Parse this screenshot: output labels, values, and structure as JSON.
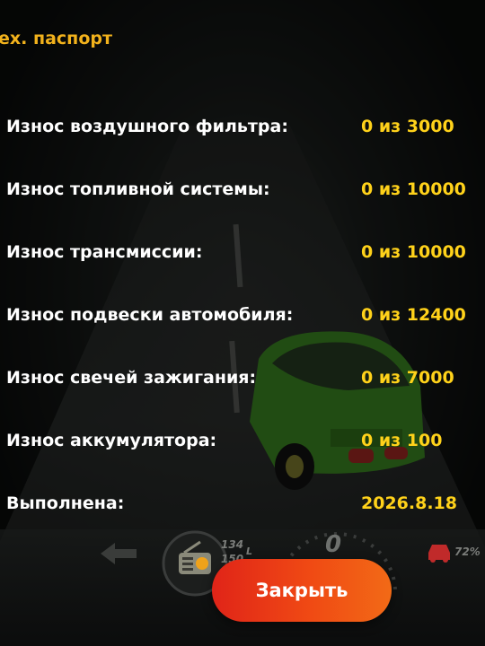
{
  "panel": {
    "title": "ex. паспорт",
    "rows": [
      {
        "label": "Износ воздушного фильтра:",
        "value": "0 из 3000"
      },
      {
        "label": "Износ топливной системы:",
        "value": "0 из 10000"
      },
      {
        "label": "Износ трансмиссии:",
        "value": "0 из 10000"
      },
      {
        "label": "Износ подвески автомобиля:",
        "value": "0 из 12400"
      },
      {
        "label": "Износ свечей зажигания:",
        "value": "0 из 7000"
      },
      {
        "label": "Износ аккумулятора:",
        "value": "0 из 100"
      },
      {
        "label": "Выполнена:",
        "value": "2026.8.18"
      }
    ],
    "close_label": "Закрыть"
  },
  "hud": {
    "fuel_top": "134",
    "fuel_bottom": "150",
    "fuel_unit": "L",
    "speed": "0",
    "damage_percent": "72%",
    "icons": [
      "back-arrow-icon",
      "radio-icon",
      "speedometer-icon",
      "car-damage-icon"
    ]
  },
  "colors": {
    "title": "#f2b21c",
    "label": "#ffffff",
    "value": "#ffd21a",
    "button_start": "#e02418",
    "button_end": "#f26a16"
  }
}
